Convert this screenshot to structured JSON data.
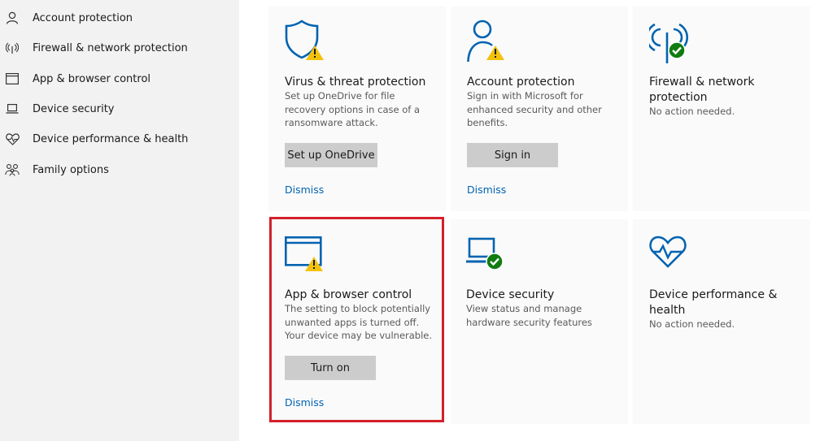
{
  "sidebar": {
    "items": [
      {
        "label": "Account protection",
        "icon": "person-icon"
      },
      {
        "label": "Firewall & network protection",
        "icon": "wireless-icon"
      },
      {
        "label": "App & browser control",
        "icon": "browser-window-icon"
      },
      {
        "label": "Device security",
        "icon": "laptop-icon"
      },
      {
        "label": "Device performance & health",
        "icon": "heart-icon"
      },
      {
        "label": "Family options",
        "icon": "family-icon"
      }
    ]
  },
  "tiles": {
    "virus": {
      "icon": "shield-warning-icon",
      "title": "Virus & threat protection",
      "description": "Set up OneDrive for file recovery options in case of a ransomware attack.",
      "button": "Set up OneDrive",
      "link": "Dismiss"
    },
    "account": {
      "icon": "account-warning-icon",
      "title": "Account protection",
      "description": "Sign in with Microsoft for enhanced security and other benefits.",
      "button": "Sign in",
      "link": "Dismiss"
    },
    "firewall": {
      "icon": "wireless-ok-icon",
      "title": "Firewall & network protection",
      "description": "No action needed."
    },
    "app_browser": {
      "icon": "browser-warning-icon",
      "title": "App & browser control",
      "description": "The setting to block potentially unwanted apps is turned off. Your device may be vulnerable.",
      "button": "Turn on",
      "link": "Dismiss"
    },
    "device_security": {
      "icon": "laptop-ok-icon",
      "title": "Device security",
      "description": "View status and manage hardware security features"
    },
    "device_health": {
      "icon": "heart-pulse-icon",
      "title": "Device performance & health",
      "description": "No action needed."
    }
  },
  "colors": {
    "accent_blue": "#0063b1",
    "warning_yellow": "#f4c20d",
    "ok_green": "#107c10",
    "highlight_red": "#d4202a"
  }
}
